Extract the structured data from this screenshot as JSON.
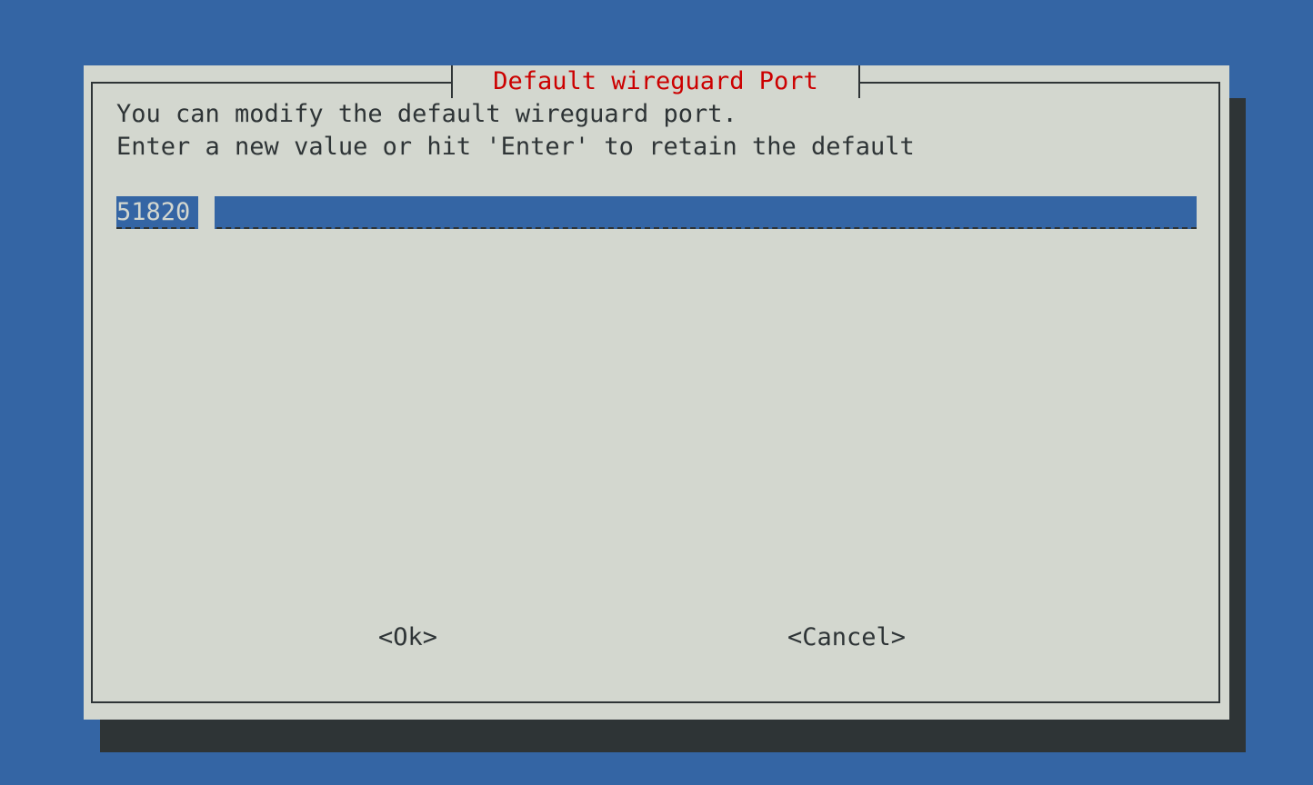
{
  "dialog": {
    "title": "Default wireguard Port",
    "message_line1": "You can modify the default wireguard port.",
    "message_line2": "Enter a new value or hit 'Enter' to retain the default",
    "input_value": "51820",
    "ok_label": "<Ok>",
    "cancel_label": "<Cancel>"
  },
  "colors": {
    "background": "#3465a4",
    "dialog": "#d3d7cf",
    "title": "#cc0000",
    "shadow": "#2e3436",
    "text": "#2e3436"
  }
}
